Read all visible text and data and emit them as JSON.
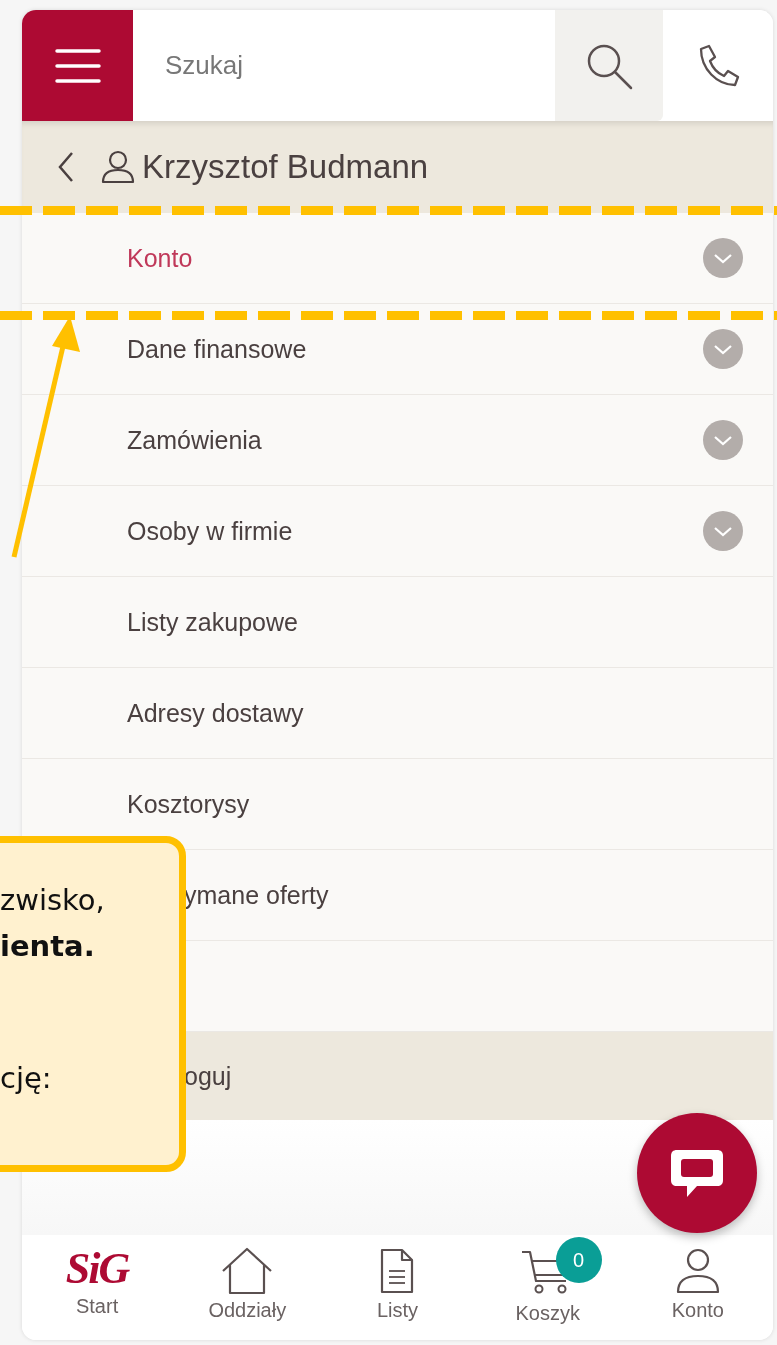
{
  "search": {
    "placeholder": "Szukaj"
  },
  "header": {
    "name": "Krzysztof Budmann"
  },
  "menu": [
    {
      "label": "Konto",
      "kind": "expandable",
      "selected": true
    },
    {
      "label": "Dane finansowe",
      "kind": "expandable",
      "selected": false
    },
    {
      "label": "Zamówienia",
      "kind": "expandable",
      "selected": false
    },
    {
      "label": "Osoby w firmie",
      "kind": "expandable",
      "selected": false
    },
    {
      "label": "Listy zakupowe",
      "kind": "plain",
      "selected": false
    },
    {
      "label": "Adresy dostawy",
      "kind": "plain",
      "selected": false
    },
    {
      "label": "Kosztorysy",
      "kind": "plain",
      "selected": false
    },
    {
      "label": "ymane oferty",
      "kind": "covered",
      "selected": false
    }
  ],
  "logout": {
    "label": "oguj"
  },
  "bottom_nav": [
    {
      "label": "Start",
      "kind": "logo",
      "logo": "SiG"
    },
    {
      "label": "Oddziały",
      "kind": "home"
    },
    {
      "label": "Listy",
      "kind": "document"
    },
    {
      "label": "Koszyk",
      "kind": "cart",
      "badge": "0"
    },
    {
      "label": "Konto",
      "kind": "user"
    }
  ],
  "callout": {
    "lines": [
      {
        "text": "zwisko,",
        "bold": false
      },
      {
        "text": "ienta.",
        "bold": true
      },
      {
        "text": "cję:",
        "bold": false
      }
    ]
  }
}
